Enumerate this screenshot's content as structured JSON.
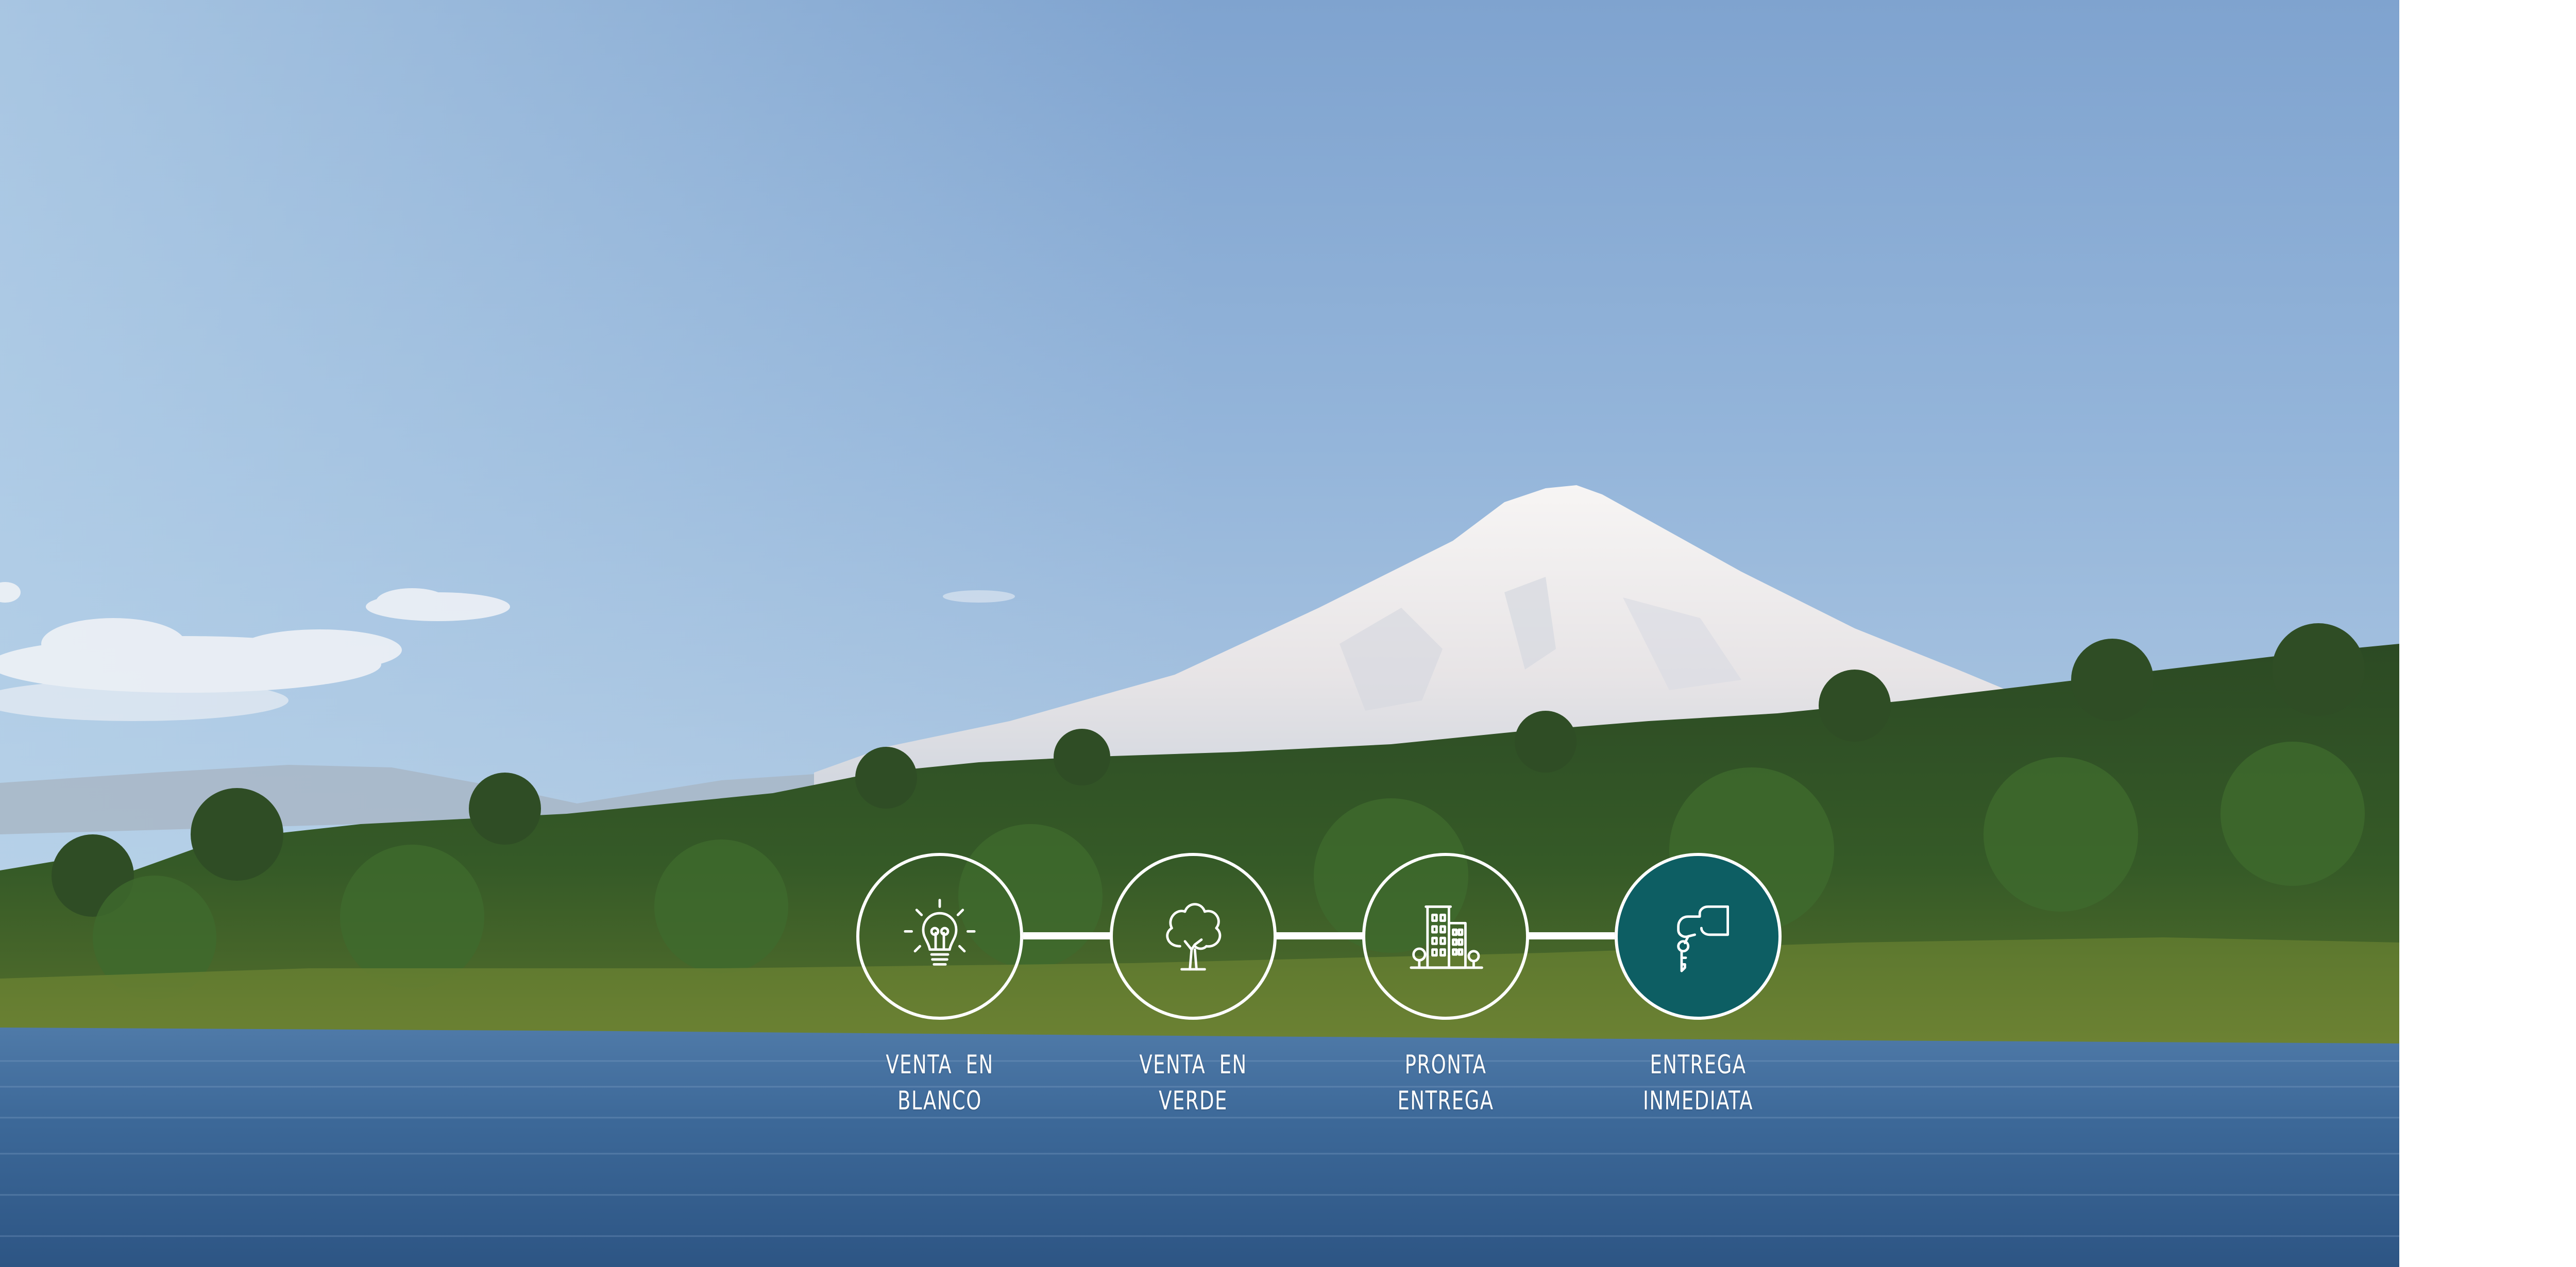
{
  "colors": {
    "active_step": "#0d5e63",
    "step_outline": "#ffffff",
    "label_text": "#ffffff",
    "page_background": "#ffffff"
  },
  "photo": {
    "icon": "volcano-lake-landscape-photo"
  },
  "stepper": {
    "active_index": 3,
    "steps": [
      {
        "icon": "lightbulb-icon",
        "line1": "VENTA  EN",
        "line2": "BLANCO"
      },
      {
        "icon": "tree-icon",
        "line1": "VENTA  EN",
        "line2": "VERDE"
      },
      {
        "icon": "buildings-icon",
        "line1": "PRONTA",
        "line2": "ENTREGA"
      },
      {
        "icon": "hand-key-icon",
        "line1": "ENTREGA",
        "line2": "INMEDIATA"
      }
    ]
  }
}
